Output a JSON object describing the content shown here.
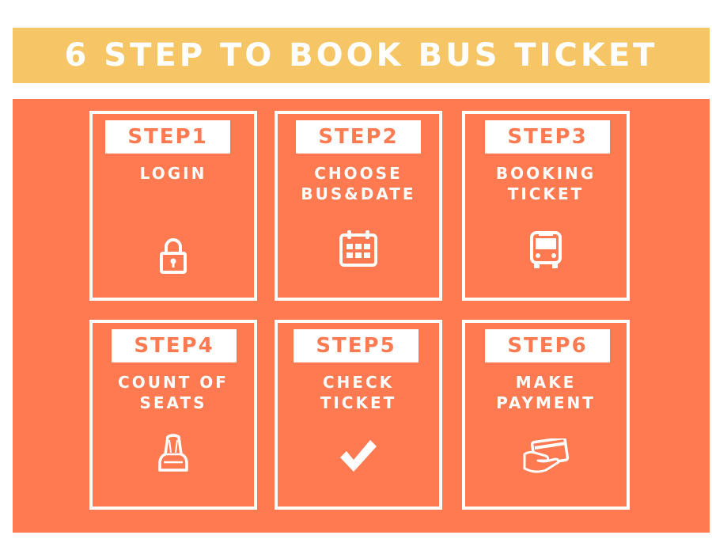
{
  "header": {
    "title": "6 STEP TO BOOK BUS TICKET"
  },
  "steps": [
    {
      "label": "STEP1",
      "title": "LOGIN",
      "icon": "lock-icon"
    },
    {
      "label": "STEP2",
      "title": "CHOOSE BUS&DATE",
      "icon": "calendar-icon"
    },
    {
      "label": "STEP3",
      "title": "BOOKING TICKET",
      "icon": "bus-icon"
    },
    {
      "label": "STEP4",
      "title": "COUNT OF SEATS",
      "icon": "seat-icon"
    },
    {
      "label": "STEP5",
      "title": "CHECK TICKET",
      "icon": "checkmark-icon"
    },
    {
      "label": "STEP6",
      "title": "MAKE PAYMENT",
      "icon": "credit-card-icon"
    }
  ],
  "colors": {
    "banner": "#f6c565",
    "panel": "#ff7a50",
    "accent": "#ffffff"
  }
}
